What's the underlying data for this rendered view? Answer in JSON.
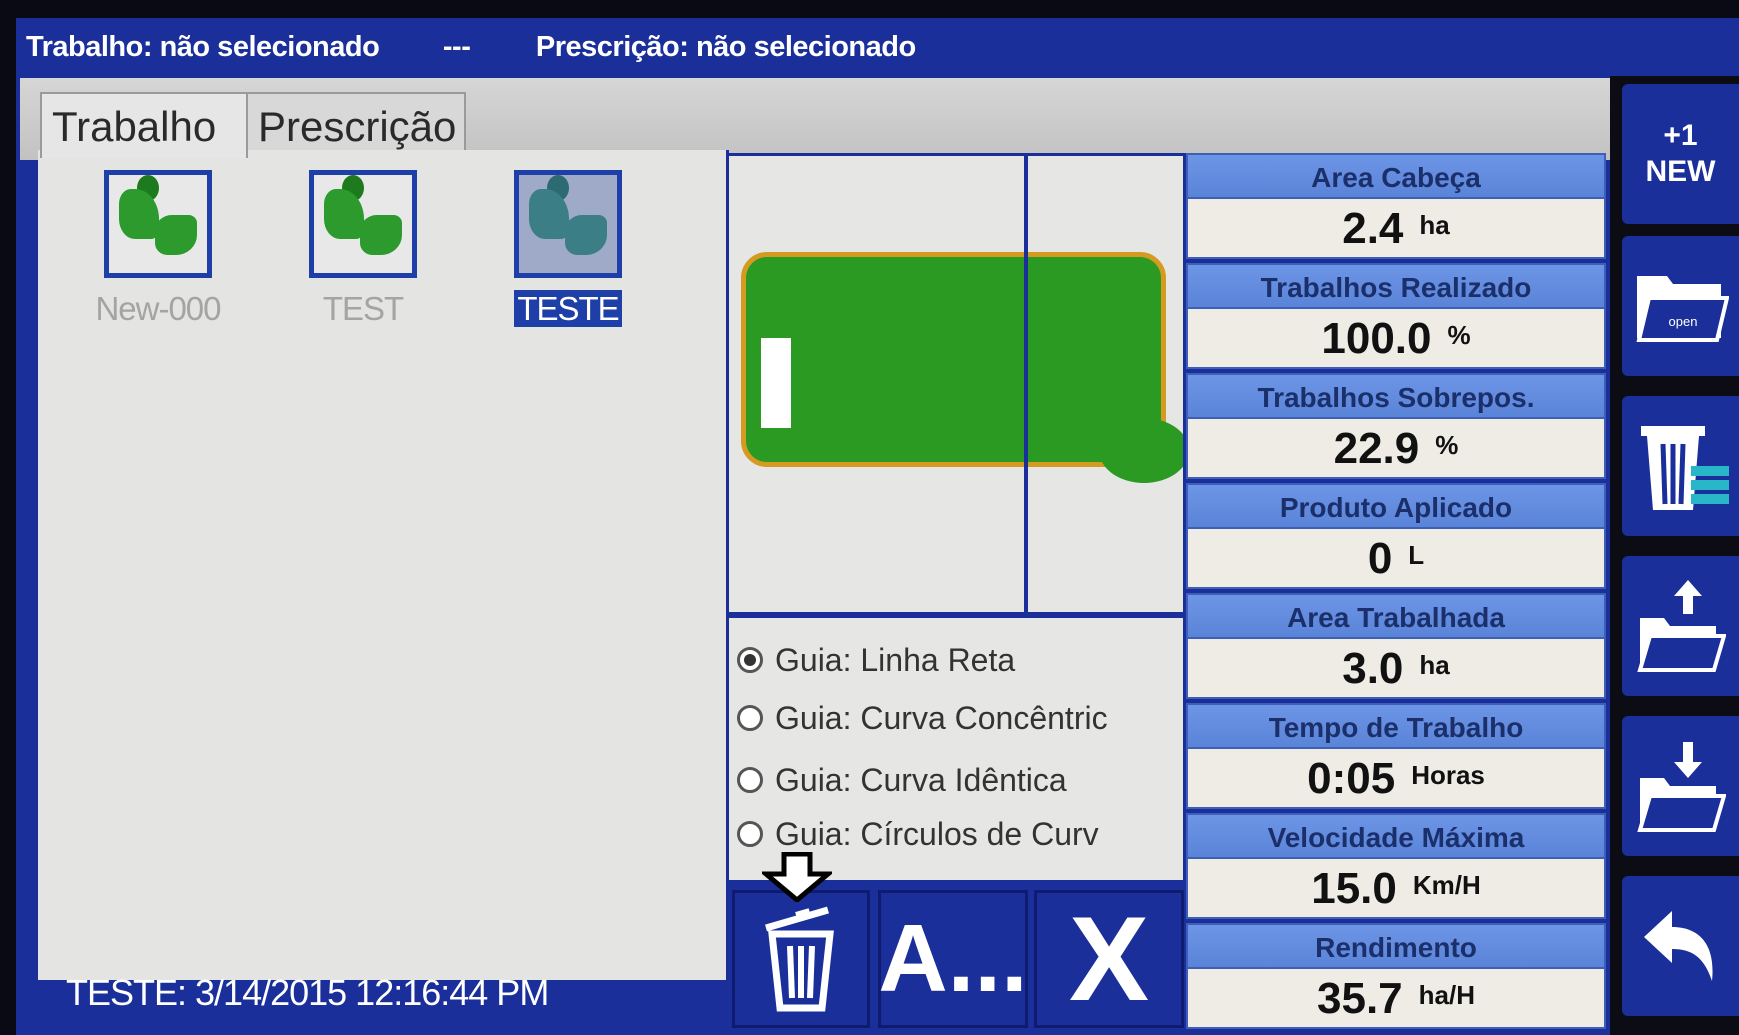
{
  "titlebar": {
    "job": "Trabalho: não selecionado",
    "separator": "---",
    "prescription": "Prescrição: não selecionado"
  },
  "tabs": [
    {
      "label": "Trabalho",
      "active": true
    },
    {
      "label": "Prescrição",
      "active": false
    }
  ],
  "jobs": [
    {
      "label": "New-000",
      "selected": false
    },
    {
      "label": "TEST",
      "selected": false
    },
    {
      "label": "TESTE",
      "selected": true
    }
  ],
  "status": "TESTE: 3/14/2015 12:16:44 PM",
  "guides": [
    {
      "label": "Guia: Linha Reta",
      "checked": true
    },
    {
      "label": "Guia: Curva Concêntric",
      "checked": false
    },
    {
      "label": "Guia: Curva Idêntica",
      "checked": false
    },
    {
      "label": "Guia: Círculos de Curv",
      "checked": false
    }
  ],
  "actions": {
    "delete_icon": "trash-icon",
    "rename_label": "A...",
    "cancel_label": "X"
  },
  "stats": [
    {
      "label": "Area Cabeça",
      "value": "2.4",
      "unit": "ha"
    },
    {
      "label": "Trabalhos Realizado",
      "value": "100.0",
      "unit": "%"
    },
    {
      "label": "Trabalhos Sobrepos.",
      "value": "22.9",
      "unit": "%"
    },
    {
      "label": "Produto Aplicado",
      "value": "0",
      "unit": "L"
    },
    {
      "label": "Area Trabalhada",
      "value": "3.0",
      "unit": "ha"
    },
    {
      "label": "Tempo de Trabalho",
      "value": "0:05",
      "unit": "Horas"
    },
    {
      "label": "Velocidade Máxima",
      "value": "15.0",
      "unit": "Km/H"
    },
    {
      "label": "Rendimento",
      "value": "35.7",
      "unit": "ha/H"
    }
  ],
  "sidebar": {
    "new_plus": "+1",
    "new_label": "NEW",
    "open_label": "open",
    "icons": [
      "new-icon",
      "open-folder-icon",
      "delete-icon",
      "export-folder-icon",
      "import-folder-icon",
      "back-arrow-icon"
    ]
  },
  "colors": {
    "frame": "#1b2f9a",
    "panel": "#e4e4e2",
    "field": "#2a9a22",
    "field_border": "#d59a20",
    "stat_header": "#6d95e6"
  }
}
